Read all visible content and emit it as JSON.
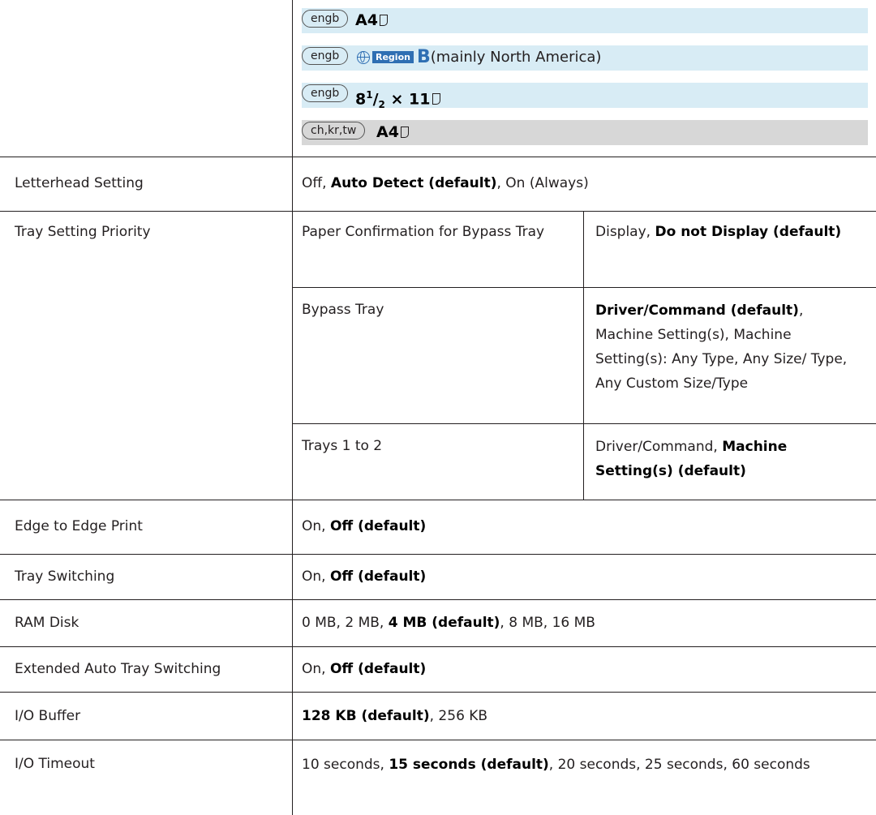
{
  "region_bands": [
    {
      "tag": "engb",
      "text": "A4",
      "icon": "paper-portrait-icon"
    },
    {
      "tag": "engb",
      "region_label": "Region",
      "region_letter": "B",
      "text": "(mainly North America)",
      "icon": "globe-icon"
    },
    {
      "tag": "engb",
      "text_main": "8",
      "sup": "1",
      "sub_rest": "/",
      "sub": "2",
      "tail": " × 11",
      "icon": "paper-portrait-icon"
    },
    {
      "tag": "ch,kr,tw",
      "text": "A4",
      "icon": "paper-portrait-icon"
    }
  ],
  "rows": {
    "letterhead": {
      "label": "Letterhead Setting",
      "pre": "Off, ",
      "bold": "Auto Detect (default)",
      "post": ", On (Always)"
    },
    "tray_priority": {
      "label": "Tray Setting Priority",
      "sub1": {
        "label": "Paper Confirmation for Bypass Tray",
        "pre": "Display, ",
        "bold": "Do not Display (default)",
        "post": ""
      },
      "sub2": {
        "label": "Bypass Tray",
        "pre": "",
        "bold": "Driver/Command (default)",
        "post": ", Machine Setting(s), Machine Setting(s): Any Type, Any Size/ Type, Any Custom Size/Type"
      },
      "sub3": {
        "label": "Trays 1 to 2",
        "pre": "Driver/Command, ",
        "bold": "Machine Setting(s) (default)",
        "post": ""
      }
    },
    "edge": {
      "label": "Edge to Edge Print",
      "pre": "On, ",
      "bold": "Off (default)",
      "post": ""
    },
    "tray_switch": {
      "label": "Tray Switching",
      "pre": "On, ",
      "bold": "Off (default)",
      "post": ""
    },
    "ram": {
      "label": "RAM Disk",
      "pre": "0 MB, 2 MB, ",
      "bold": "4 MB (default)",
      "post": ", 8 MB, 16 MB"
    },
    "ext_tray": {
      "label": "Extended Auto Tray Switching",
      "pre": "On, ",
      "bold": "Off (default)",
      "post": ""
    },
    "io_buffer": {
      "label": "I/O Buffer",
      "pre": "",
      "bold": "128 KB (default)",
      "post": ", 256 KB"
    },
    "io_timeout": {
      "label": "I/O Timeout",
      "pre": "10 seconds, ",
      "bold": "15 seconds (default)",
      "post": ", 20 seconds, 25 seconds, 60 seconds"
    }
  }
}
